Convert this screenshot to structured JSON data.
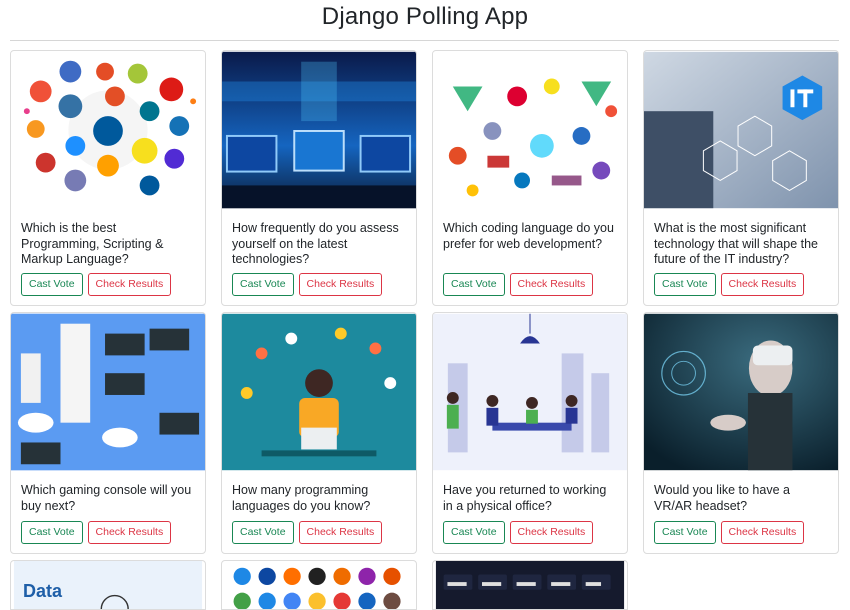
{
  "header": {
    "title": "Django Polling App"
  },
  "buttons": {
    "vote": "Cast Vote",
    "results": "Check Results"
  },
  "polls": [
    {
      "question": "Which is the best Programming, Scripting & Markup Language?",
      "image": "programming-languages-logos-image"
    },
    {
      "question": "How frequently do you assess yourself on the latest technologies?",
      "image": "monitors-tech-image"
    },
    {
      "question": "Which coding language do you prefer for web development?",
      "image": "web-tech-logos-image"
    },
    {
      "question": "What is the most significant technology that will shape the future of the IT industry?",
      "image": "it-touchscreen-image"
    },
    {
      "question": "Which gaming console will you buy next?",
      "image": "gaming-consoles-image"
    },
    {
      "question": "How many programming languages do you know?",
      "image": "programmer-illustration-image"
    },
    {
      "question": "Have you returned to working in a physical office?",
      "image": "office-meeting-illustration-image"
    },
    {
      "question": "Would you like to have a VR/AR headset?",
      "image": "vr-headset-image"
    }
  ],
  "partial_cards": [
    {
      "image_text": "Data",
      "image": "data-analytics-image"
    },
    {
      "image": "browser-icons-image"
    },
    {
      "image": "dashboard-dark-image"
    }
  ]
}
